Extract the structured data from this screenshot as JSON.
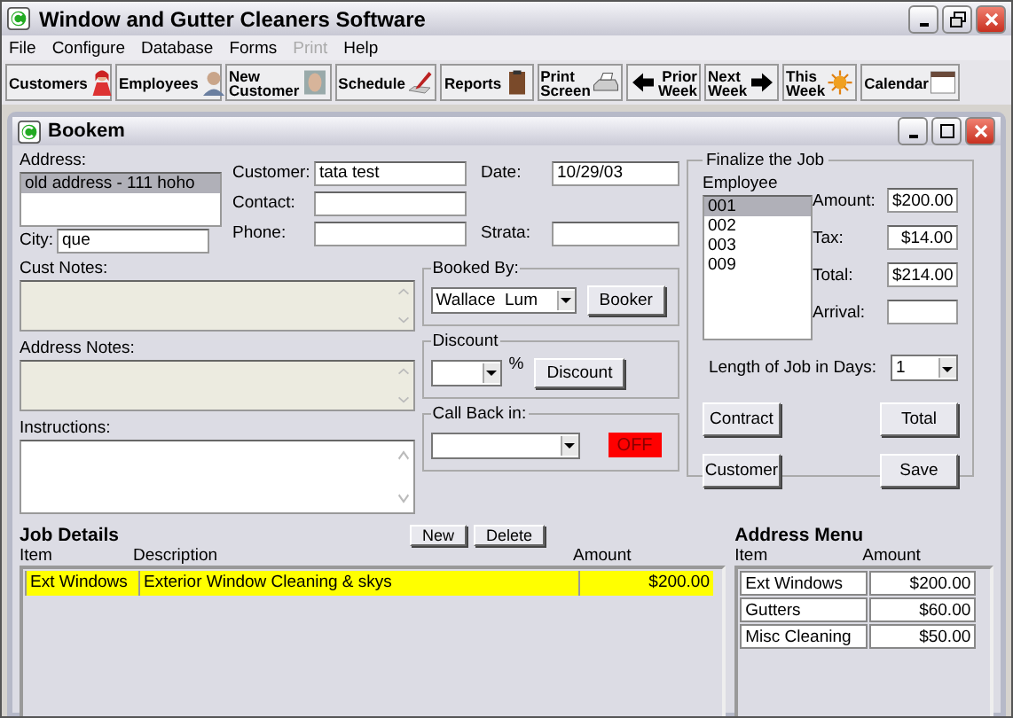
{
  "window": {
    "title": "Window and Gutter Cleaners Software"
  },
  "menu": [
    {
      "label": "File",
      "disabled": false
    },
    {
      "label": "Configure",
      "disabled": false
    },
    {
      "label": "Database",
      "disabled": false
    },
    {
      "label": "Forms",
      "disabled": false
    },
    {
      "label": "Print",
      "disabled": true
    },
    {
      "label": "Help",
      "disabled": false
    }
  ],
  "toolbar": [
    {
      "label": "Customers",
      "kind": "woman"
    },
    {
      "label": "Employees",
      "kind": "man"
    },
    {
      "label": "New Customer",
      "kind": "face"
    },
    {
      "label": "Schedule",
      "kind": "pencil"
    },
    {
      "label": "Reports",
      "kind": "clipboard"
    },
    {
      "label": "Print Screen",
      "kind": "printer"
    },
    {
      "label": "Prior Week",
      "kind": "arrow-left"
    },
    {
      "label": "Next Week",
      "kind": "arrow-right"
    },
    {
      "label": "This Week",
      "kind": "sun"
    },
    {
      "label": "Calendar",
      "kind": "calendar"
    }
  ],
  "form": {
    "title": "Bookem",
    "address": {
      "label": "Address:",
      "items": [
        {
          "text": "old address - 111 hoho",
          "selected": true
        }
      ]
    },
    "city": {
      "label": "City:",
      "value": "que"
    },
    "fields": [
      {
        "label": "Customer:",
        "value": "tata test"
      },
      {
        "label": "Date:",
        "value": "10/29/03"
      },
      {
        "label": "Contact:"
      },
      {
        "label": "Phone:"
      },
      {
        "label": "Strata:"
      }
    ],
    "notes": [
      {
        "label": "Cust Notes:",
        "disabled": true
      },
      {
        "label": "Address Notes:",
        "disabled": true
      },
      {
        "label": "Instructions:",
        "disabled": false
      }
    ],
    "booked_by": {
      "legend": "Booked By:",
      "value": "Wallace  Lum",
      "button": "Booker"
    },
    "discount": {
      "legend": "Discount",
      "unit": "%",
      "button": "Discount"
    },
    "call_back": {
      "legend": "Call Back in:",
      "toggle": {
        "label": "OFF",
        "on": false
      }
    },
    "finalize": {
      "legend": "Finalize the Job",
      "employee_label": "Employee",
      "employees": [
        {
          "text": "001",
          "selected": true
        },
        {
          "text": "002",
          "selected": false
        },
        {
          "text": "003",
          "selected": false
        },
        {
          "text": "009",
          "selected": false
        }
      ],
      "amounts": [
        {
          "label": "Amount:",
          "value": "$200.00"
        },
        {
          "label": "Tax:",
          "value": "$14.00"
        },
        {
          "label": "Total:",
          "value": "$214.00"
        },
        {
          "label": "Arrival:"
        }
      ],
      "length_label": "Length of Job in Days:",
      "length_value": "1",
      "buttons": [
        "Contract",
        "Total",
        "Customer",
        "Save"
      ]
    },
    "job_details": {
      "title": "Job Details",
      "buttons": [
        "New",
        "Delete"
      ],
      "columns": [
        "Item",
        "Description",
        "Amount"
      ],
      "rows": [
        {
          "cells": [
            "Ext Windows",
            "Exterior Window Cleaning & skys",
            "$200.00"
          ],
          "selected": true
        }
      ]
    },
    "address_menu": {
      "title": "Address Menu",
      "columns": [
        "Item",
        "Amount"
      ],
      "rows": [
        {
          "cells": [
            "Ext Windows",
            "$200.00"
          ]
        },
        {
          "cells": [
            "Gutters",
            "$60.00"
          ]
        },
        {
          "cells": [
            "Misc Cleaning",
            "$50.00"
          ]
        }
      ]
    }
  }
}
